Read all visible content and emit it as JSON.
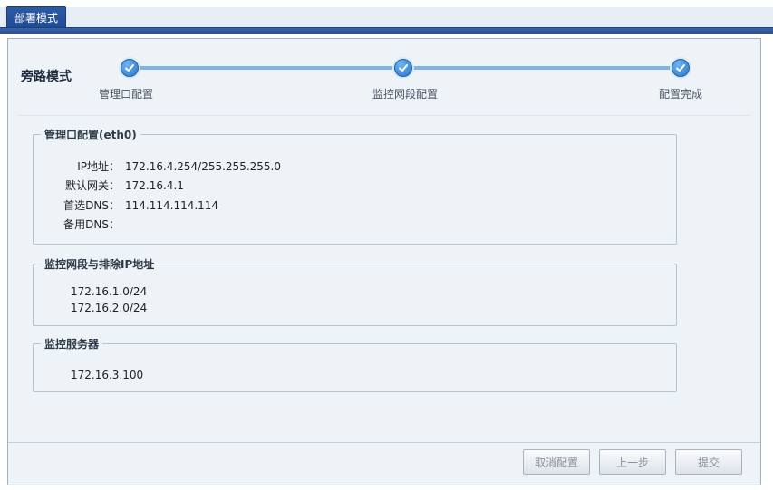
{
  "tab": {
    "label": "部署模式"
  },
  "wizard": {
    "title": "旁路模式",
    "steps": [
      {
        "label": "管理口配置"
      },
      {
        "label": "监控网段配置"
      },
      {
        "label": "配置完成"
      }
    ]
  },
  "management": {
    "legend": "管理口配置(eth0)",
    "fields": [
      {
        "label": "IP地址：",
        "value": "172.16.4.254/255.255.255.0"
      },
      {
        "label": "默认网关：",
        "value": "172.16.4.1"
      },
      {
        "label": "首选DNS：",
        "value": "114.114.114.114"
      },
      {
        "label": "备用DNS：",
        "value": ""
      }
    ]
  },
  "monitor_segments": {
    "legend": "监控网段与排除IP地址",
    "items": [
      "172.16.1.0/24",
      "172.16.2.0/24"
    ]
  },
  "monitor_server": {
    "legend": "监控服务器",
    "items": [
      "172.16.3.100"
    ]
  },
  "buttons": {
    "cancel": "取消配置",
    "prev": "上一步",
    "submit": "提交"
  },
  "colors": {
    "accent": "#2a78c8",
    "tab_bg": "#2d5aa6",
    "panel_bg": "#eef3f8"
  }
}
